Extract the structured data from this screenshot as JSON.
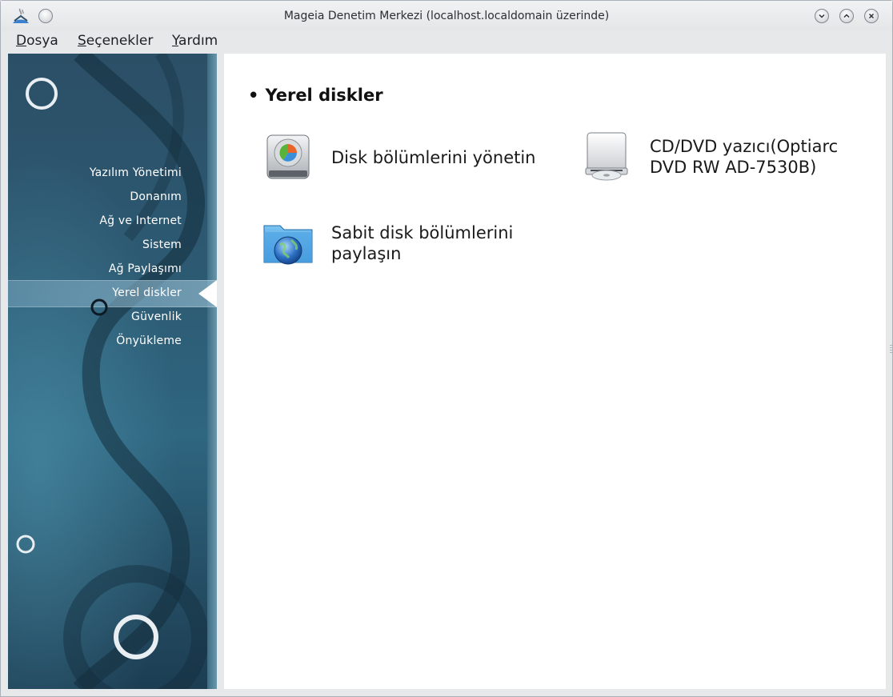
{
  "window": {
    "title": "Mageia Denetim Merkezi  (localhost.localdomain üzerinde)"
  },
  "menu": {
    "items": [
      {
        "key": "D",
        "rest": "osya"
      },
      {
        "key": "S",
        "rest": "eçenekler"
      },
      {
        "key": "Y",
        "rest": "ardım"
      }
    ]
  },
  "sidebar": {
    "items": [
      {
        "label": "Yazılım Yönetimi"
      },
      {
        "label": "Donanım"
      },
      {
        "label": "Ağ ve Internet"
      },
      {
        "label": "Sistem"
      },
      {
        "label": "Ağ Paylaşımı"
      },
      {
        "label": "Yerel diskler"
      },
      {
        "label": "Güvenlik"
      },
      {
        "label": "Önyükleme"
      }
    ],
    "selected_index": 5
  },
  "content": {
    "section_title": "Yerel diskler",
    "tiles": [
      {
        "icon": "disk-partition-icon",
        "line1": "Disk bölümlerini yönetin",
        "line2": ""
      },
      {
        "icon": "cd-dvd-drive-icon",
        "line1": "CD/DVD yazıcı(Optiarc",
        "line2": "DVD RW AD-7530B)"
      },
      {
        "icon": "shared-folder-globe-icon",
        "line1": "Sabit disk bölümlerini",
        "line2": "paylaşın"
      }
    ]
  },
  "colors": {
    "sidebar_dark": "#244c63",
    "sidebar_light": "#2f6680",
    "content_bg": "#ffffff",
    "window_bg": "#e6e8ea"
  }
}
